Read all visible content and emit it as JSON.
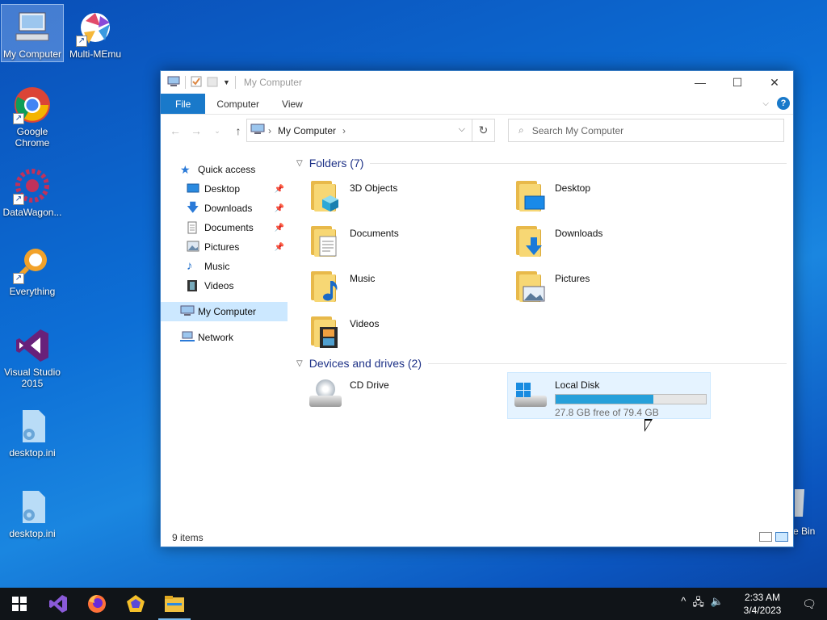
{
  "desktop": {
    "icons": [
      {
        "label": "My Computer"
      },
      {
        "label": "Multi-MEmu"
      },
      {
        "label": "Google Chrome"
      },
      {
        "label": "DataWagon..."
      },
      {
        "label": "Everything"
      },
      {
        "label": "Visual Studio 2015"
      },
      {
        "label": "desktop.ini"
      },
      {
        "label": "desktop.ini"
      }
    ],
    "recycle_partial": "e Bin"
  },
  "window": {
    "title": "My Computer",
    "controls": {
      "minimize": "—",
      "maximize": "☐",
      "close": "✕"
    },
    "ribbon_tabs": [
      "File",
      "Computer",
      "View"
    ],
    "help": "?",
    "address": {
      "crumb": "My Computer"
    },
    "search": {
      "placeholder": "Search My Computer"
    },
    "nav": {
      "quick_access": "Quick access",
      "items": [
        {
          "label": "Desktop"
        },
        {
          "label": "Downloads"
        },
        {
          "label": "Documents"
        },
        {
          "label": "Pictures"
        },
        {
          "label": "Music"
        },
        {
          "label": "Videos"
        }
      ],
      "my_computer": "My Computer",
      "network": "Network"
    },
    "folders_header": "Folders (7)",
    "folders": [
      {
        "name": "3D Objects",
        "icon": "cube-icon"
      },
      {
        "name": "Desktop",
        "icon": "monitor-icon"
      },
      {
        "name": "Documents",
        "icon": "document-icon"
      },
      {
        "name": "Downloads",
        "icon": "download-arrow-icon"
      },
      {
        "name": "Music",
        "icon": "music-note-icon"
      },
      {
        "name": "Pictures",
        "icon": "picture-icon"
      },
      {
        "name": "Videos",
        "icon": "film-icon"
      }
    ],
    "devices_header": "Devices and drives (2)",
    "drives": {
      "cd": {
        "name": "CD Drive"
      },
      "local": {
        "name": "Local Disk",
        "free_text": "27.8 GB free of 79.4 GB",
        "used_fraction": 0.65
      }
    },
    "status": "9 items"
  },
  "taskbar": {
    "clock_time": "2:33 AM",
    "clock_date": "3/4/2023"
  },
  "colors": {
    "accent": "#1979ca",
    "selection": "#cce8ff",
    "bar_fill": "#26a0da"
  }
}
